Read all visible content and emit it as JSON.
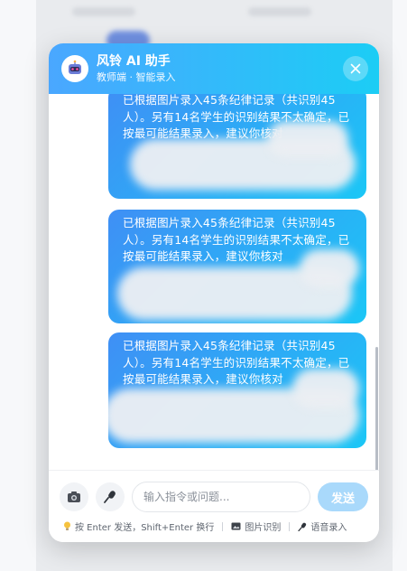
{
  "assistant": {
    "title": "风铃 AI 助手",
    "subtitle": "教师端 · 智能录入"
  },
  "messages": [
    {
      "text": "已根据图片录入45条纪律记录（共识别45人）。另有14名学生的识别结果不太确定，已按最可能结果录入，建议你核对"
    },
    {
      "text": "已根据图片录入45条纪律记录（共识别45人）。另有14名学生的识别结果不太确定，已按最可能结果录入，建议你核对"
    },
    {
      "text": "已根据图片录入45条纪律记录（共识别45人）。另有14名学生的识别结果不太确定，已按最可能结果录入，建议你核对"
    }
  ],
  "composer": {
    "placeholder": "输入指令或问题...",
    "send_label": "发送"
  },
  "hints": {
    "enter": "按 Enter 发送，Shift+Enter 换行",
    "image": "图片识别",
    "voice": "语音录入"
  },
  "colors": {
    "header_gradient_start": "#4aa7ff",
    "header_gradient_end": "#1ccdf5",
    "send_disabled": "#a9d9fb"
  },
  "icons": [
    "robot-icon",
    "close-icon",
    "camera-icon",
    "microphone-icon",
    "lightbulb-icon",
    "image-icon"
  ]
}
